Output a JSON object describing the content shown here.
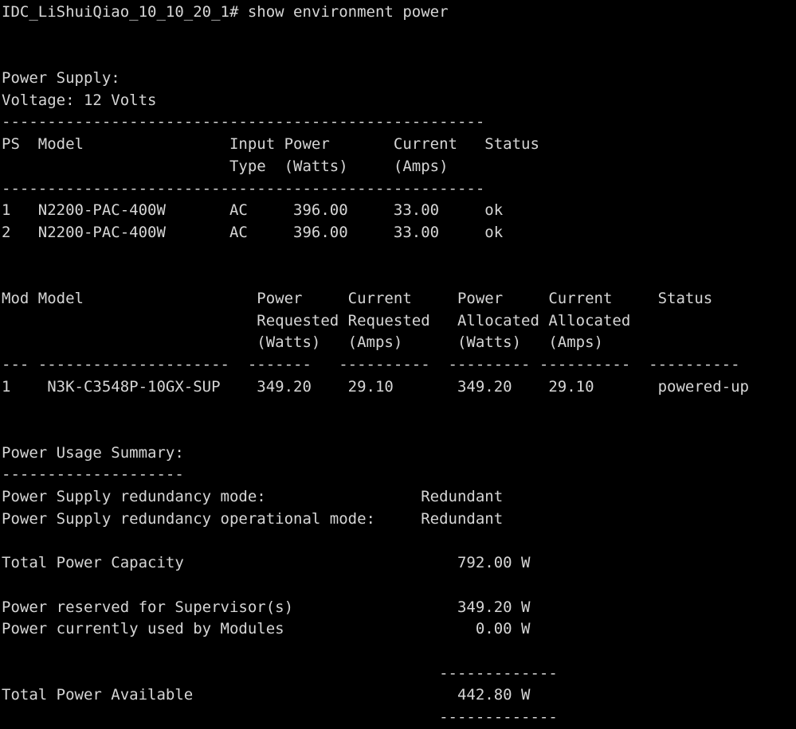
{
  "terminal": {
    "background_color": "#000000",
    "text_color": "#d6d6d6",
    "lines": [
      "IDC_LiShuiQiao_10_10_20_1# show environment power",
      "",
      "",
      "Power Supply:",
      "Voltage: 12 Volts",
      "-----------------------------------------------------",
      "PS  Model                Input Power       Current   Status",
      "                         Type  (Watts)     (Amps)",
      "-----------------------------------------------------",
      "1   N2200-PAC-400W       AC     396.00     33.00     ok",
      "2   N2200-PAC-400W       AC     396.00     33.00     ok",
      "",
      "",
      "Mod Model                   Power     Current     Power     Current     Status",
      "                            Requested Requested   Allocated Allocated",
      "                            (Watts)   (Amps)      (Watts)   (Amps)",
      "--- ---------------------  -------   ----------  --------- ----------  ----------",
      "1    N3K-C3548P-10GX-SUP    349.20    29.10       349.20    29.10       powered-up",
      "",
      "",
      "Power Usage Summary:",
      "--------------------",
      "Power Supply redundancy mode:                 Redundant",
      "Power Supply redundancy operational mode:     Redundant",
      "",
      "Total Power Capacity                              792.00 W",
      "",
      "Power reserved for Supervisor(s)                  349.20 W",
      "Power currently used by Modules                     0.00 W",
      "",
      "                                                -------------",
      "Total Power Available                             442.80 W",
      "                                                -------------"
    ]
  }
}
